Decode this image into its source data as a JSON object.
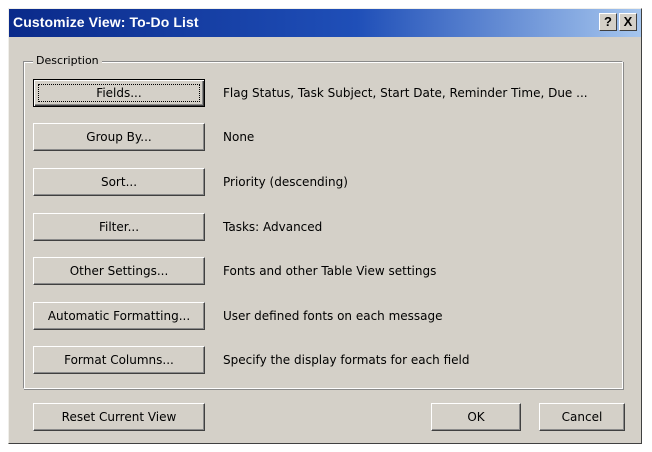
{
  "window": {
    "title": "Customize View: To-Do List",
    "help_glyph": "?",
    "close_glyph": "X"
  },
  "group": {
    "label": "Description"
  },
  "rows": [
    {
      "button": "Fields...",
      "description": "Flag Status, Task Subject, Start Date, Reminder Time, Due ..."
    },
    {
      "button": "Group By...",
      "description": "None"
    },
    {
      "button": "Sort...",
      "description": "Priority (descending)"
    },
    {
      "button": "Filter...",
      "description": "Tasks: Advanced"
    },
    {
      "button": "Other Settings...",
      "description": "Fonts and other Table View settings"
    },
    {
      "button": "Automatic Formatting...",
      "description": "User defined fonts on each message"
    },
    {
      "button": "Format Columns...",
      "description": "Specify the display formats for each field"
    }
  ],
  "footer": {
    "reset_label": "Reset Current View",
    "ok_label": "OK",
    "cancel_label": "Cancel"
  }
}
